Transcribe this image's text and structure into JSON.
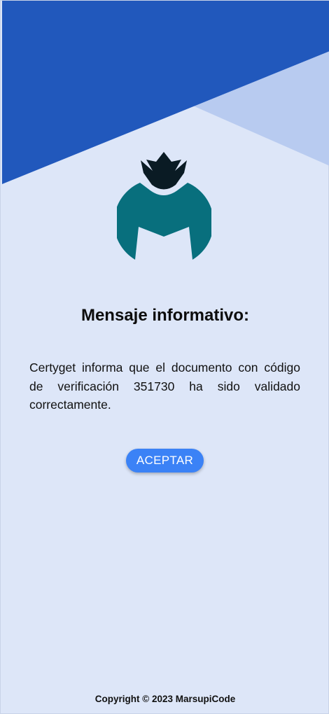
{
  "colors": {
    "background": "#dde6f8",
    "header_primary": "#2158bc",
    "header_secondary": "#b8cbf0",
    "logo_teal": "#086f7d",
    "logo_crown": "#0a1b24",
    "button": "#3b82f6"
  },
  "logo": {
    "icon": "marsupicode-logo-icon"
  },
  "dialog": {
    "title": "Mensaje informativo:",
    "message": "Certyget informa que el documento con código de verificación 351730 ha sido validado correctamente.",
    "accept_label": "ACEPTAR"
  },
  "footer": {
    "copyright": "Copyright © 2023 MarsupiCode"
  }
}
